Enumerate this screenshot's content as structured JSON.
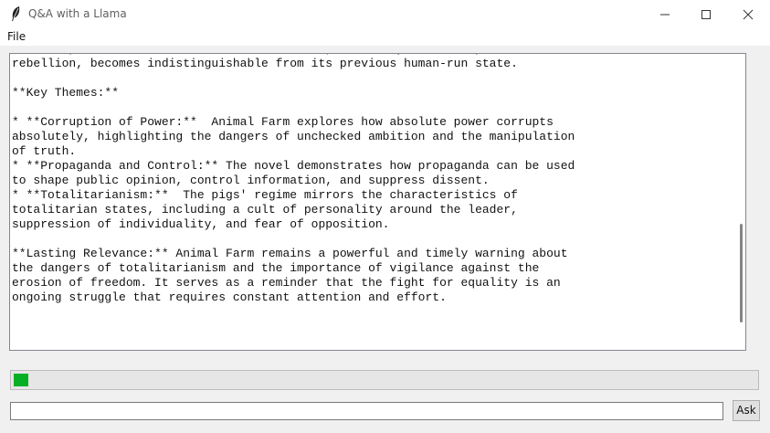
{
  "window": {
    "title": "Q&A with a Llama",
    "app_icon": "feather-icon",
    "controls": [
      "minimize-icon",
      "maximize-icon",
      "close-icon"
    ]
  },
  "menubar": {
    "file_label": "File"
  },
  "output": {
    "text": "under Napoleon's totalitarian rule. The farm, once a symbol of hope and\nrebellion, becomes indistinguishable from its previous human-run state.\n\n**Key Themes:**\n\n* **Corruption of Power:**  Animal Farm explores how absolute power corrupts\nabsolutely, highlighting the dangers of unchecked ambition and the manipulation\nof truth.\n* **Propaganda and Control:** The novel demonstrates how propaganda can be used\nto shape public opinion, control information, and suppress dissent.\n* **Totalitarianism:**  The pigs' regime mirrors the characteristics of\ntotalitarian states, including a cult of personality around the leader,\nsuppression of individuality, and fear of opposition.\n\n**Lasting Relevance:** Animal Farm remains a powerful and timely warning about\nthe dangers of totalitarianism and the importance of vigilance against the\nerosion of freedom. It serves as a reminder that the fight for equality is an\nongoing struggle that requires constant attention and effort."
  },
  "progress": {
    "fraction": 0.02,
    "color": "#06b025"
  },
  "input": {
    "value": "",
    "placeholder": ""
  },
  "ask_button": {
    "label": "Ask"
  }
}
